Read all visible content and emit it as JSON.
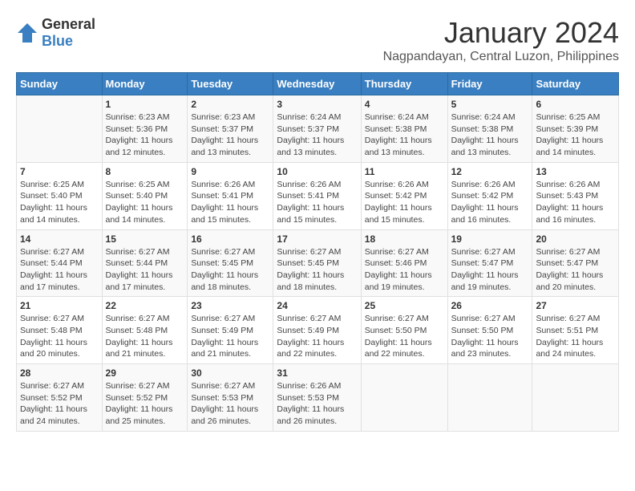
{
  "header": {
    "logo_general": "General",
    "logo_blue": "Blue",
    "main_title": "January 2024",
    "subtitle": "Nagpandayan, Central Luzon, Philippines"
  },
  "calendar": {
    "weekdays": [
      "Sunday",
      "Monday",
      "Tuesday",
      "Wednesday",
      "Thursday",
      "Friday",
      "Saturday"
    ],
    "weeks": [
      [
        {
          "day": "",
          "info": ""
        },
        {
          "day": "1",
          "info": "Sunrise: 6:23 AM\nSunset: 5:36 PM\nDaylight: 11 hours\nand 12 minutes."
        },
        {
          "day": "2",
          "info": "Sunrise: 6:23 AM\nSunset: 5:37 PM\nDaylight: 11 hours\nand 13 minutes."
        },
        {
          "day": "3",
          "info": "Sunrise: 6:24 AM\nSunset: 5:37 PM\nDaylight: 11 hours\nand 13 minutes."
        },
        {
          "day": "4",
          "info": "Sunrise: 6:24 AM\nSunset: 5:38 PM\nDaylight: 11 hours\nand 13 minutes."
        },
        {
          "day": "5",
          "info": "Sunrise: 6:24 AM\nSunset: 5:38 PM\nDaylight: 11 hours\nand 13 minutes."
        },
        {
          "day": "6",
          "info": "Sunrise: 6:25 AM\nSunset: 5:39 PM\nDaylight: 11 hours\nand 14 minutes."
        }
      ],
      [
        {
          "day": "7",
          "info": "Sunrise: 6:25 AM\nSunset: 5:40 PM\nDaylight: 11 hours\nand 14 minutes."
        },
        {
          "day": "8",
          "info": "Sunrise: 6:25 AM\nSunset: 5:40 PM\nDaylight: 11 hours\nand 14 minutes."
        },
        {
          "day": "9",
          "info": "Sunrise: 6:26 AM\nSunset: 5:41 PM\nDaylight: 11 hours\nand 15 minutes."
        },
        {
          "day": "10",
          "info": "Sunrise: 6:26 AM\nSunset: 5:41 PM\nDaylight: 11 hours\nand 15 minutes."
        },
        {
          "day": "11",
          "info": "Sunrise: 6:26 AM\nSunset: 5:42 PM\nDaylight: 11 hours\nand 15 minutes."
        },
        {
          "day": "12",
          "info": "Sunrise: 6:26 AM\nSunset: 5:42 PM\nDaylight: 11 hours\nand 16 minutes."
        },
        {
          "day": "13",
          "info": "Sunrise: 6:26 AM\nSunset: 5:43 PM\nDaylight: 11 hours\nand 16 minutes."
        }
      ],
      [
        {
          "day": "14",
          "info": "Sunrise: 6:27 AM\nSunset: 5:44 PM\nDaylight: 11 hours\nand 17 minutes."
        },
        {
          "day": "15",
          "info": "Sunrise: 6:27 AM\nSunset: 5:44 PM\nDaylight: 11 hours\nand 17 minutes."
        },
        {
          "day": "16",
          "info": "Sunrise: 6:27 AM\nSunset: 5:45 PM\nDaylight: 11 hours\nand 18 minutes."
        },
        {
          "day": "17",
          "info": "Sunrise: 6:27 AM\nSunset: 5:45 PM\nDaylight: 11 hours\nand 18 minutes."
        },
        {
          "day": "18",
          "info": "Sunrise: 6:27 AM\nSunset: 5:46 PM\nDaylight: 11 hours\nand 19 minutes."
        },
        {
          "day": "19",
          "info": "Sunrise: 6:27 AM\nSunset: 5:47 PM\nDaylight: 11 hours\nand 19 minutes."
        },
        {
          "day": "20",
          "info": "Sunrise: 6:27 AM\nSunset: 5:47 PM\nDaylight: 11 hours\nand 20 minutes."
        }
      ],
      [
        {
          "day": "21",
          "info": "Sunrise: 6:27 AM\nSunset: 5:48 PM\nDaylight: 11 hours\nand 20 minutes."
        },
        {
          "day": "22",
          "info": "Sunrise: 6:27 AM\nSunset: 5:48 PM\nDaylight: 11 hours\nand 21 minutes."
        },
        {
          "day": "23",
          "info": "Sunrise: 6:27 AM\nSunset: 5:49 PM\nDaylight: 11 hours\nand 21 minutes."
        },
        {
          "day": "24",
          "info": "Sunrise: 6:27 AM\nSunset: 5:49 PM\nDaylight: 11 hours\nand 22 minutes."
        },
        {
          "day": "25",
          "info": "Sunrise: 6:27 AM\nSunset: 5:50 PM\nDaylight: 11 hours\nand 22 minutes."
        },
        {
          "day": "26",
          "info": "Sunrise: 6:27 AM\nSunset: 5:50 PM\nDaylight: 11 hours\nand 23 minutes."
        },
        {
          "day": "27",
          "info": "Sunrise: 6:27 AM\nSunset: 5:51 PM\nDaylight: 11 hours\nand 24 minutes."
        }
      ],
      [
        {
          "day": "28",
          "info": "Sunrise: 6:27 AM\nSunset: 5:52 PM\nDaylight: 11 hours\nand 24 minutes."
        },
        {
          "day": "29",
          "info": "Sunrise: 6:27 AM\nSunset: 5:52 PM\nDaylight: 11 hours\nand 25 minutes."
        },
        {
          "day": "30",
          "info": "Sunrise: 6:27 AM\nSunset: 5:53 PM\nDaylight: 11 hours\nand 26 minutes."
        },
        {
          "day": "31",
          "info": "Sunrise: 6:26 AM\nSunset: 5:53 PM\nDaylight: 11 hours\nand 26 minutes."
        },
        {
          "day": "",
          "info": ""
        },
        {
          "day": "",
          "info": ""
        },
        {
          "day": "",
          "info": ""
        }
      ]
    ]
  }
}
